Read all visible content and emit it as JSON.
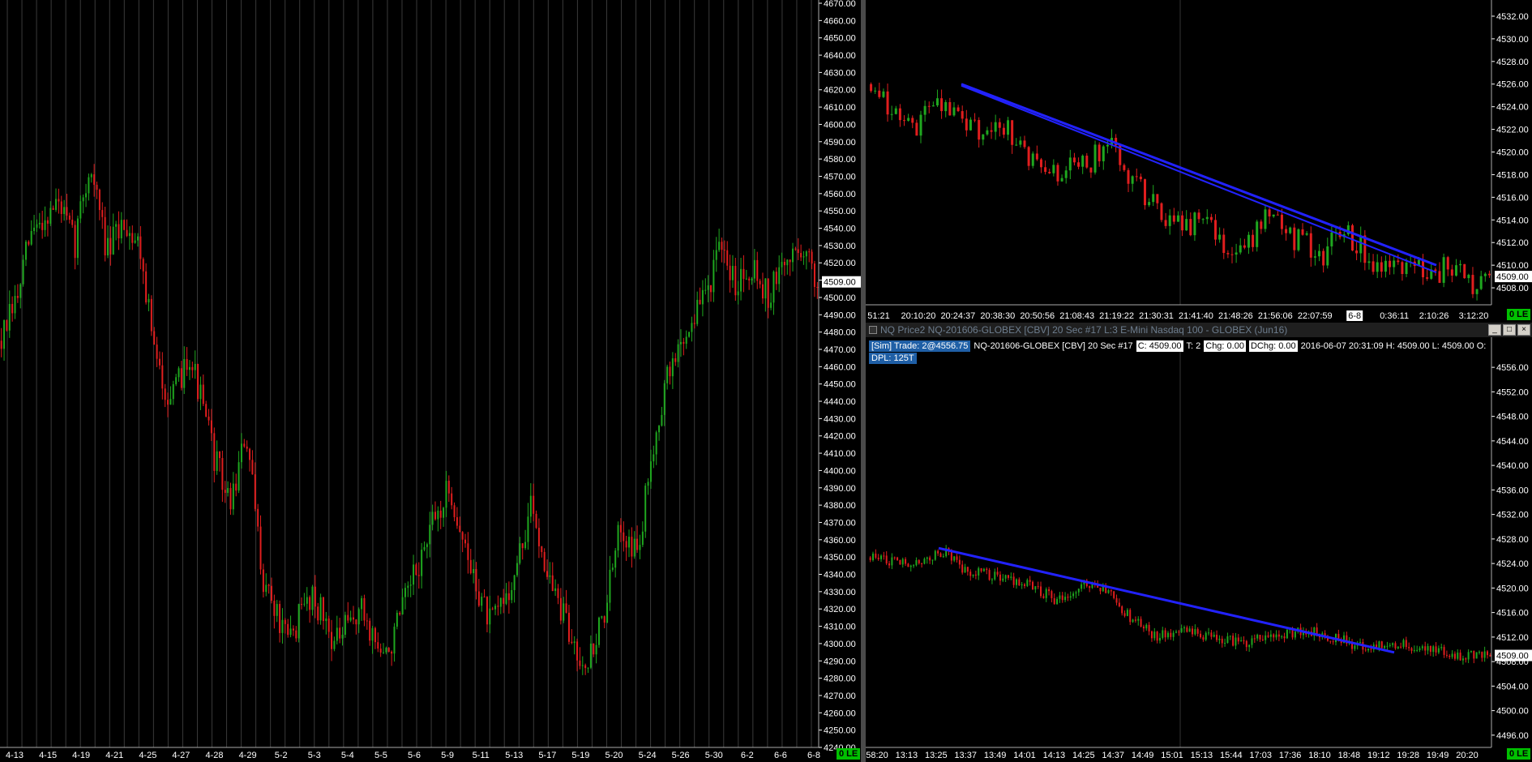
{
  "panels": {
    "left": {
      "status": "0 LE",
      "last_price": "4509.00",
      "y_ticks": [
        "4670.00",
        "4660.00",
        "4650.00",
        "4640.00",
        "4630.00",
        "4620.00",
        "4610.00",
        "4600.00",
        "4590.00",
        "4580.00",
        "4570.00",
        "4560.00",
        "4550.00",
        "4540.00",
        "4530.00",
        "4520.00",
        "4510.00",
        "4500.00",
        "4490.00",
        "4480.00",
        "4470.00",
        "4460.00",
        "4450.00",
        "4440.00",
        "4430.00",
        "4420.00",
        "4410.00",
        "4400.00",
        "4390.00",
        "4380.00",
        "4370.00",
        "4360.00",
        "4350.00",
        "4340.00",
        "4330.00",
        "4320.00",
        "4310.00",
        "4300.00",
        "4290.00",
        "4280.00",
        "4270.00",
        "4260.00",
        "4250.00",
        "4240.00"
      ],
      "x_ticks": [
        "4-13",
        "4-15",
        "4-19",
        "4-21",
        "4-25",
        "4-27",
        "4-28",
        "4-29",
        "5-2",
        "5-3",
        "5-4",
        "5-5",
        "5-6",
        "5-9",
        "5-11",
        "5-13",
        "5-17",
        "5-19",
        "5-20",
        "5-24",
        "5-26",
        "5-30",
        "6-2",
        "6-6",
        "6-8"
      ]
    },
    "top_right": {
      "status": "0 LE",
      "last_price": "4509.00",
      "date_marker": "6-8",
      "y_ticks": [
        "4532.00",
        "4530.00",
        "4528.00",
        "4526.00",
        "4524.00",
        "4522.00",
        "4520.00",
        "4518.00",
        "4516.00",
        "4514.00",
        "4512.00",
        "4510.00",
        "4508.00"
      ],
      "x_ticks": [
        "51:21",
        "20:10:20",
        "20:24:37",
        "20:38:30",
        "20:50:56",
        "21:08:43",
        "21:19:22",
        "21:30:31",
        "21:41:40",
        "21:48:26",
        "21:56:06",
        "22:07:59",
        "6-8",
        "0:36:11",
        "2:10:26",
        "3:12:20"
      ]
    },
    "bottom_right": {
      "title": "NQ Price2  NQ-201606-GLOBEX [CBV]  20 Sec  #17  L:3  E-Mini Nasdaq 100 - GLOBEX (Jun16)",
      "window_buttons": [
        "_",
        "□",
        "×"
      ],
      "status": "0 LE",
      "last_price": "4509.00",
      "info": {
        "sim_trade": "[Sim]  Trade: 2@4556.75",
        "instrument": "NQ-201606-GLOBEX [CBV]  20 Sec   #17",
        "close": "C: 4509.00",
        "ticks": "T: 2",
        "chg": "Chg: 0.00",
        "dchg": "DChg: 0.00",
        "datetime": "2016-06-07 20:31:09 H: 4509.00  L: 4509.00  O:",
        "dpl": "DPL: 125T"
      },
      "y_ticks": [
        "4556.00",
        "4552.00",
        "4548.00",
        "4544.00",
        "4540.00",
        "4536.00",
        "4532.00",
        "4528.00",
        "4524.00",
        "4520.00",
        "4516.00",
        "4512.00",
        "4508.00",
        "4504.00",
        "4500.00",
        "4496.00"
      ],
      "x_ticks": [
        "58:20",
        "13:13",
        "13:25",
        "13:37",
        "13:49",
        "14:01",
        "14:13",
        "14:25",
        "14:37",
        "14:49",
        "15:01",
        "15:13",
        "15:44",
        "17:03",
        "17:36",
        "18:10",
        "18:48",
        "19:12",
        "19:28",
        "19:49",
        "20:20"
      ]
    }
  },
  "colors": {
    "up": "#1fa71f",
    "down": "#e01e1e",
    "trendline": "#2222ff",
    "grid": "#3a3a3a",
    "axis_text": "#ffffff",
    "status_bg": "#00c000"
  },
  "chart_data": [
    {
      "type": "candlestick",
      "name": "left",
      "x_range": [
        "4-13",
        "6-8"
      ],
      "ylim": [
        4240,
        4670
      ],
      "keypoints": [
        [
          0,
          4475
        ],
        [
          0.02,
          4500
        ],
        [
          0.035,
          4535
        ],
        [
          0.05,
          4545
        ],
        [
          0.07,
          4555
        ],
        [
          0.09,
          4530
        ],
        [
          0.1,
          4560
        ],
        [
          0.11,
          4575
        ],
        [
          0.13,
          4525
        ],
        [
          0.15,
          4545
        ],
        [
          0.17,
          4530
        ],
        [
          0.19,
          4460
        ],
        [
          0.21,
          4440
        ],
        [
          0.23,
          4470
        ],
        [
          0.26,
          4410
        ],
        [
          0.28,
          4380
        ],
        [
          0.3,
          4420
        ],
        [
          0.32,
          4340
        ],
        [
          0.35,
          4300
        ],
        [
          0.38,
          4330
        ],
        [
          0.41,
          4300
        ],
        [
          0.44,
          4320
        ],
        [
          0.47,
          4290
        ],
        [
          0.5,
          4330
        ],
        [
          0.53,
          4370
        ],
        [
          0.55,
          4390
        ],
        [
          0.57,
          4350
        ],
        [
          0.6,
          4310
        ],
        [
          0.63,
          4340
        ],
        [
          0.65,
          4380
        ],
        [
          0.67,
          4340
        ],
        [
          0.7,
          4300
        ],
        [
          0.72,
          4290
        ],
        [
          0.74,
          4320
        ],
        [
          0.76,
          4370
        ],
        [
          0.78,
          4350
        ],
        [
          0.8,
          4420
        ],
        [
          0.82,
          4460
        ],
        [
          0.84,
          4480
        ],
        [
          0.86,
          4500
        ],
        [
          0.88,
          4525
        ],
        [
          0.9,
          4510
        ],
        [
          0.92,
          4520
        ],
        [
          0.94,
          4500
        ],
        [
          0.96,
          4520
        ],
        [
          0.98,
          4530
        ],
        [
          1,
          4509
        ]
      ]
    },
    {
      "type": "candlestick",
      "name": "top_right",
      "x_range": [
        "51:21",
        "3:12:20"
      ],
      "ylim": [
        4506.5,
        4533
      ],
      "keypoints": [
        [
          0,
          4526
        ],
        [
          0.03,
          4524
        ],
        [
          0.07,
          4522
        ],
        [
          0.1,
          4525
        ],
        [
          0.13,
          4523.5
        ],
        [
          0.17,
          4522
        ],
        [
          0.2,
          4523
        ],
        [
          0.25,
          4520
        ],
        [
          0.3,
          4518
        ],
        [
          0.35,
          4519
        ],
        [
          0.39,
          4521
        ],
        [
          0.43,
          4517
        ],
        [
          0.47,
          4515
        ],
        [
          0.5,
          4513
        ],
        [
          0.53,
          4514
        ],
        [
          0.57,
          4512
        ],
        [
          0.6,
          4511
        ],
        [
          0.63,
          4514
        ],
        [
          0.67,
          4513
        ],
        [
          0.7,
          4512
        ],
        [
          0.73,
          4511
        ],
        [
          0.77,
          4513
        ],
        [
          0.8,
          4511
        ],
        [
          0.83,
          4510
        ],
        [
          0.87,
          4510.5
        ],
        [
          0.9,
          4509
        ],
        [
          0.94,
          4510
        ],
        [
          0.97,
          4508.5
        ],
        [
          1,
          4509
        ]
      ]
    },
    {
      "type": "candlestick",
      "name": "bottom_right",
      "x_range": [
        "58:20",
        "20:20"
      ],
      "ylim": [
        4494,
        4558
      ],
      "keypoints": [
        [
          0,
          4525
        ],
        [
          0.05,
          4524
        ],
        [
          0.1,
          4525
        ],
        [
          0.12,
          4526
        ],
        [
          0.15,
          4523
        ],
        [
          0.2,
          4522
        ],
        [
          0.25,
          4521
        ],
        [
          0.3,
          4518
        ],
        [
          0.35,
          4521
        ],
        [
          0.38,
          4520
        ],
        [
          0.42,
          4515
        ],
        [
          0.46,
          4512
        ],
        [
          0.5,
          4513
        ],
        [
          0.55,
          4512
        ],
        [
          0.6,
          4511
        ],
        [
          0.65,
          4512
        ],
        [
          0.7,
          4513
        ],
        [
          0.75,
          4512
        ],
        [
          0.8,
          4510
        ],
        [
          0.85,
          4511
        ],
        [
          0.9,
          4510
        ],
        [
          0.95,
          4509
        ],
        [
          1,
          4509
        ]
      ]
    }
  ]
}
